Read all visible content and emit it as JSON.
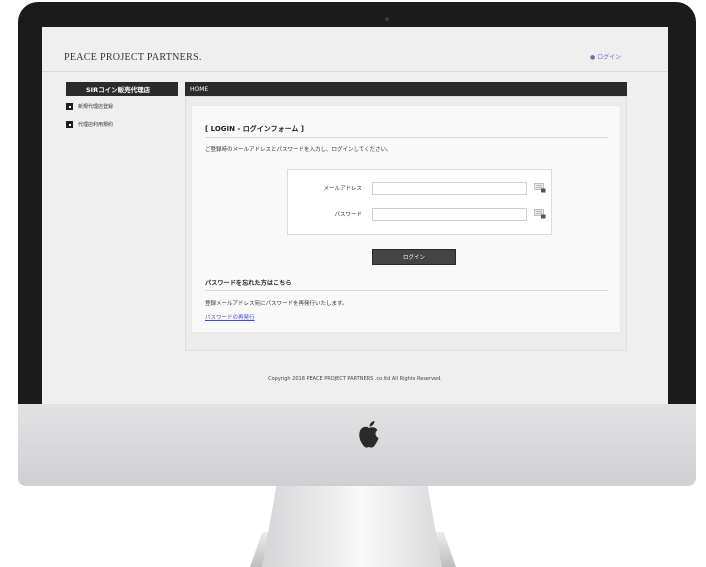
{
  "site": {
    "brand": "PEACE PROJECT PARTNERS.",
    "login_link": "● ログイン"
  },
  "sidebar": {
    "title": "SIRコイン販売代理店",
    "items": [
      {
        "label": "新規代理店登録"
      },
      {
        "label": "代理店利用規約"
      }
    ]
  },
  "breadcrumb": {
    "home": "HOME"
  },
  "login": {
    "title": "[ LOGIN - ログインフォーム ]",
    "instruction": "ご登録時のメールアドレスとパスワードを入力し、ログインしてください。",
    "email_label": "メールアドレス",
    "email_value": "",
    "password_label": "パスワード",
    "password_value": "",
    "button": "ログイン"
  },
  "forgot": {
    "heading": "パスワードを忘れた方はこちら",
    "text": "登録メールアドレス宛にパスワードを再発行いたします。",
    "link": "パスワードの再発行"
  },
  "footer": {
    "copyright": "Copyrigh 2018 PEACE PROJECT PARTNERS .co.ltd All Rights Reserved."
  },
  "colors": {
    "bezel": "#1b1b1b",
    "dark_bar": "#2b2b2b",
    "link": "#4046d6",
    "login_link": "#6a6cb8"
  },
  "icons": {
    "camera": "camera-dot-icon",
    "apple": "apple-logo-icon",
    "keyboard": "keyboard-icon",
    "bullet": "square-bullet-icon"
  }
}
